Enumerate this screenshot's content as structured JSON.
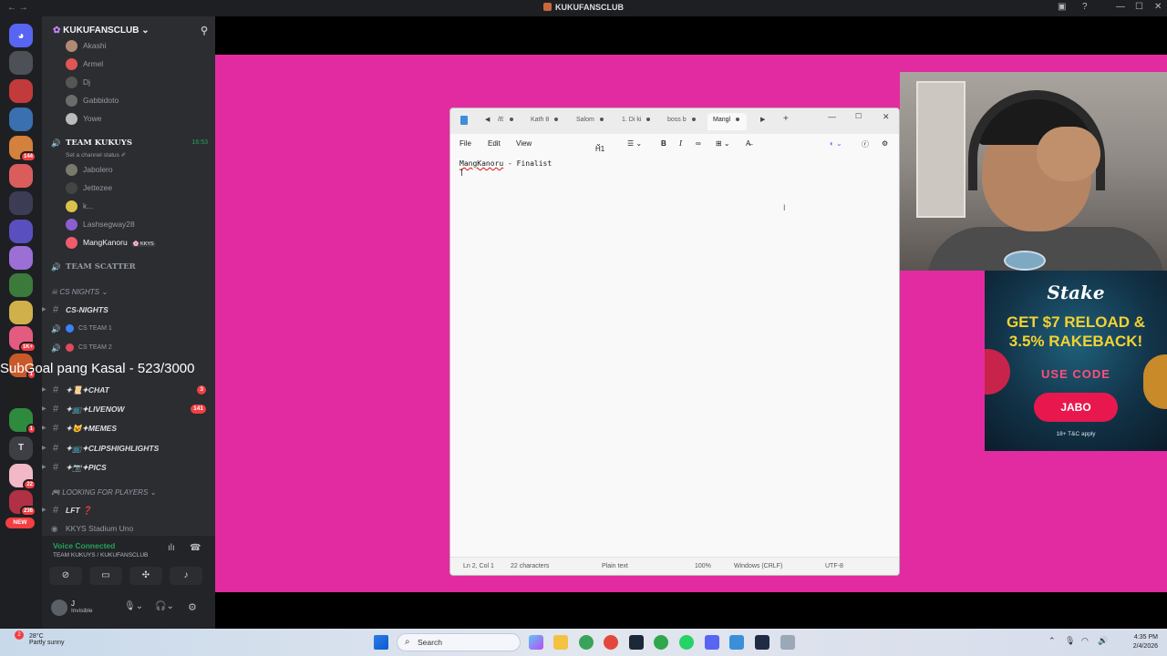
{
  "window": {
    "title": "KUKUFANSCLUB"
  },
  "servers": [
    {
      "color": "#4e5058"
    },
    {
      "color": "#c23a3a"
    },
    {
      "color": "#3a6fb0"
    },
    {
      "color": "#d3813d",
      "badge": "144"
    },
    {
      "color": "#d95d5d"
    },
    {
      "color": "#3c3c55"
    },
    {
      "color": "#5a4fbe"
    },
    {
      "color": "#9b6fd6"
    },
    {
      "color": "#3b7a3b"
    },
    {
      "color": "#d0b04a"
    },
    {
      "color": "#e35c80",
      "badge": "1K+"
    },
    {
      "color": "#c85a2a",
      "badge": "1"
    },
    {
      "color": "#1f1f1f"
    },
    {
      "color": "#2e8b3e",
      "badge": "1"
    },
    {
      "color": "#3e3f45",
      "label": "T"
    },
    {
      "color": "#f1b8c8",
      "badge": "22"
    },
    {
      "color": "#b03045",
      "badge": "236"
    }
  ],
  "rail_new_label": "NEW",
  "server_name": "KUKUFANSCLUB",
  "voice_top": [
    {
      "name": "Akashi",
      "color": "#b08a72"
    },
    {
      "name": "Armel",
      "color": "#e05555"
    },
    {
      "name": "Dj",
      "color": "#555"
    },
    {
      "name": "Gabbidoto",
      "color": "#6b6b6b"
    },
    {
      "name": "Yowe",
      "color": "#bbb"
    }
  ],
  "team_kukuys": {
    "name": "TEAM KUKUYS",
    "time": "16:53",
    "status": "Set a channel status ✐"
  },
  "voice_kukuys": [
    {
      "name": "Jabolero",
      "color": "#7a7a6a"
    },
    {
      "name": "Jettezee",
      "color": "#444"
    },
    {
      "name": "k...",
      "color": "#d9c24a"
    },
    {
      "name": "Lashsegway28",
      "color": "#8a5fd0"
    },
    {
      "name": "MangKanoru",
      "color": "#ef5b6b",
      "tag": "🌸 KKYS"
    }
  ],
  "team_scatter": "TEAM SCATTER",
  "cat_cs_nights": "CS NIGHTS",
  "cs_channels": [
    {
      "name": "CS-NIGHTS",
      "kind": "text"
    },
    {
      "name": "CS TEAM 1",
      "kind": "voice"
    },
    {
      "name": "CS TEAM 2",
      "kind": "voice"
    }
  ],
  "subgoal": "SubGoal pang Kasal - 523/3000",
  "text_channels": [
    {
      "name": "✦📜✦CHAT",
      "count": "3"
    },
    {
      "name": "✦📺✦LIVENOW",
      "count": "141"
    },
    {
      "name": "✦😺✦MEMES",
      "count": ""
    },
    {
      "name": "✦📺✦CLIPSHIGHLIGHTS",
      "count": ""
    },
    {
      "name": "✦📷✦PICS",
      "count": ""
    }
  ],
  "cat_lfp": "LOOKING FOR PLAYERS",
  "lft": "LFT ❓",
  "kkys_stadium": "KKYS Stadium Uno",
  "voice_panel": {
    "status": "Voice Connected",
    "channel": "TEAM KUKUYS / KUKUFANSCLUB"
  },
  "user": {
    "name": "J",
    "status": "Invisible"
  },
  "notepad": {
    "tabs": [
      "/E",
      "Kath 8",
      "Salom",
      "1. Di ki",
      "boss b",
      "Mangl"
    ],
    "menu": [
      "File",
      "Edit",
      "View"
    ],
    "heading_btn": "H1",
    "content_name": "MangKanoru",
    "content_rest": " - Finalist",
    "status": {
      "position": "Ln 2, Col 1",
      "chars": "22 characters",
      "format": "Plain text",
      "zoom": "100%",
      "eol": "Windows (CRLF)",
      "encoding": "UTF-8"
    }
  },
  "ad": {
    "brand": "Stake",
    "headline_1": "GET $7 RELOAD &",
    "headline_2": "3.5% RAKEBACK!",
    "use_code": "USE CODE",
    "code": "JABO",
    "tc": "18+ T&C apply"
  },
  "taskbar": {
    "temp": "28°C",
    "weather": "Partly sunny",
    "search_placeholder": "Search",
    "time": "4:35 PM",
    "date": "2/4/2026"
  }
}
